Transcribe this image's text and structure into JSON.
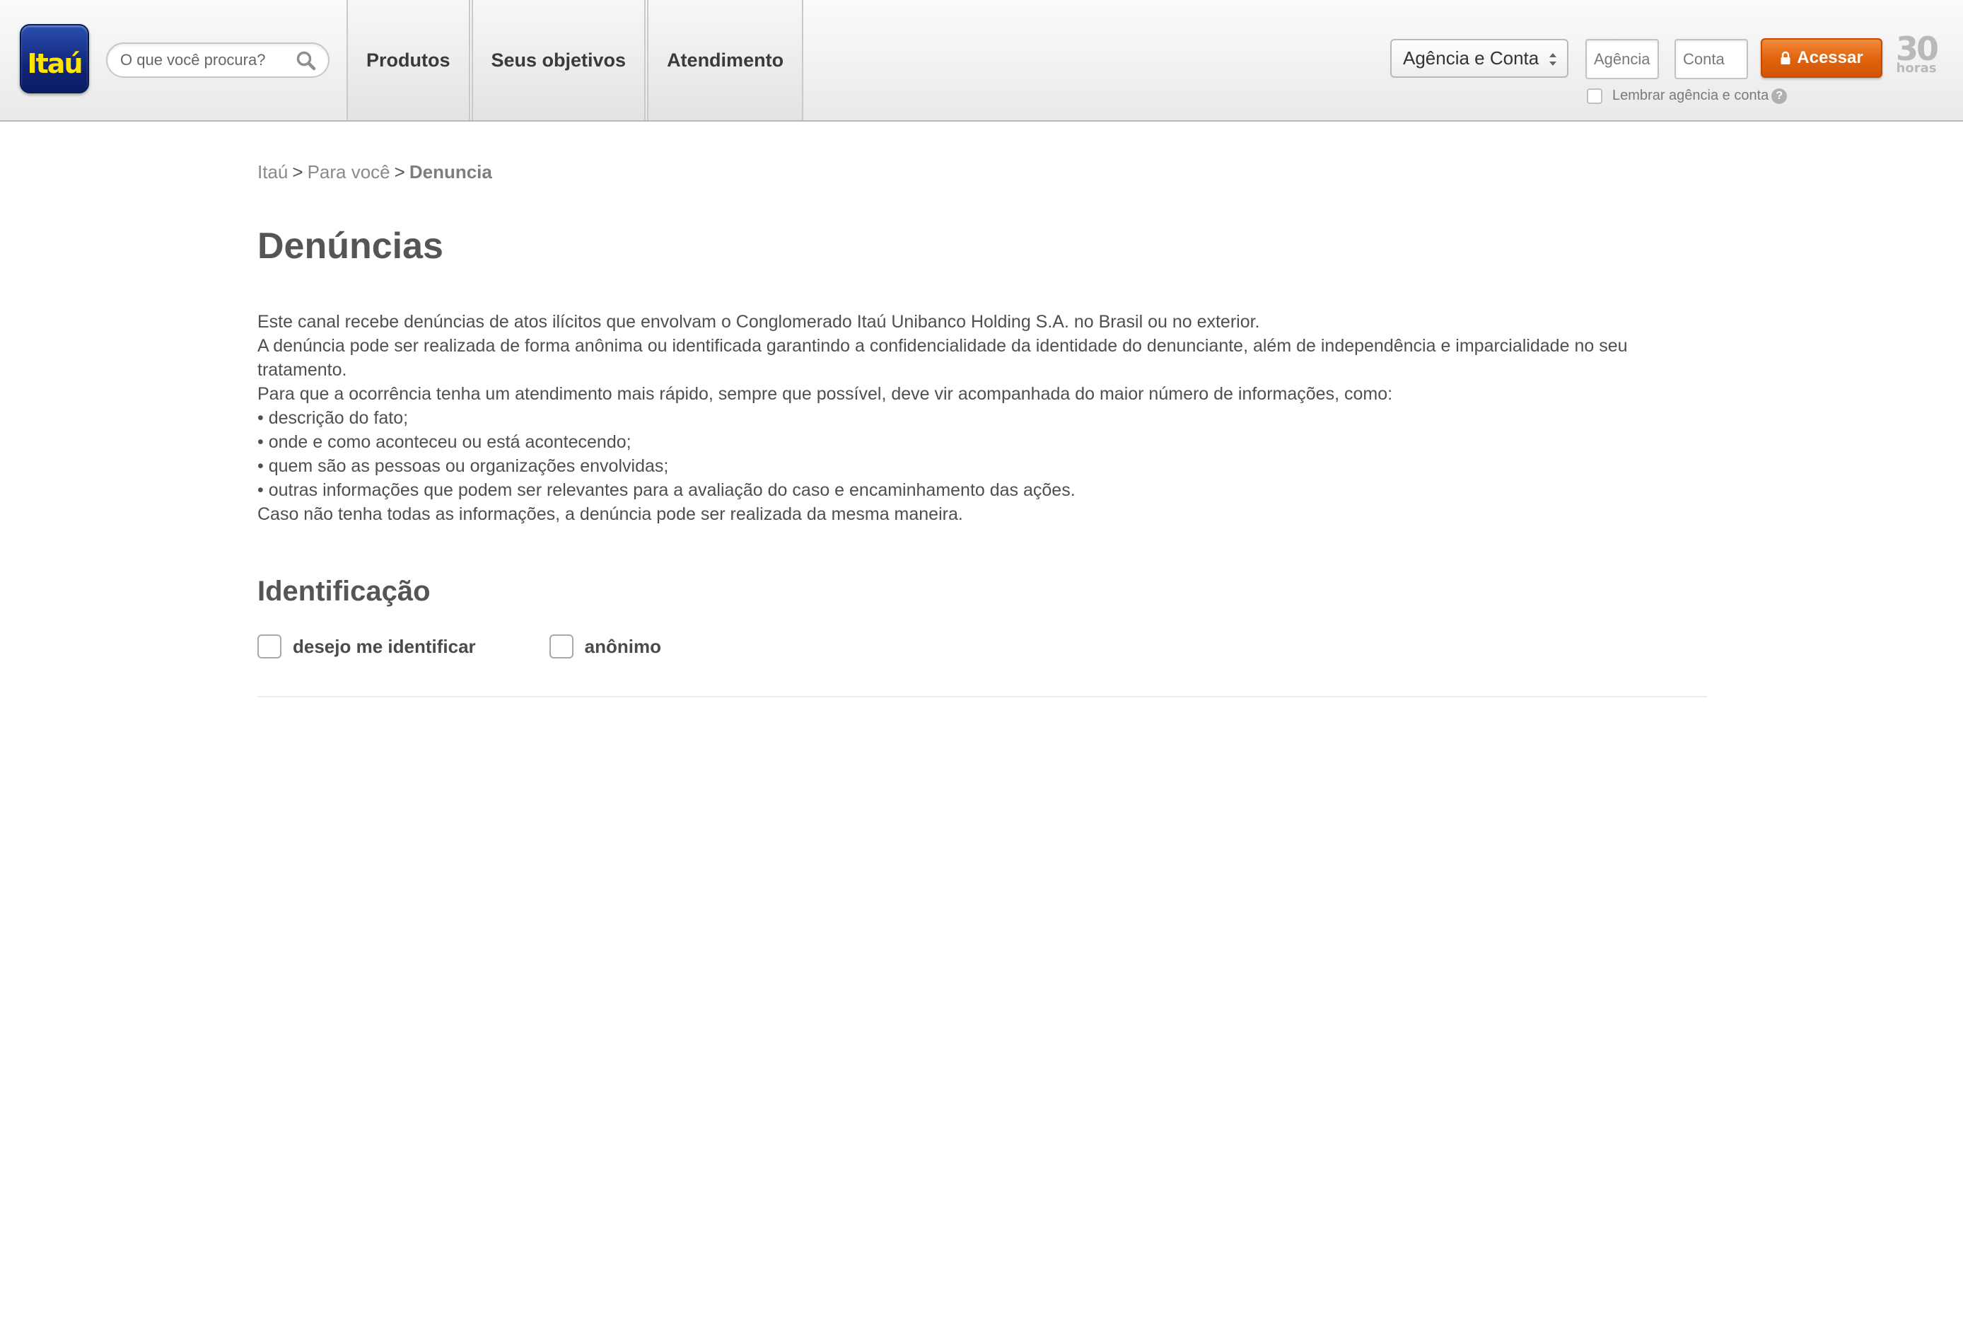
{
  "header": {
    "logo_text": "Itaú",
    "search": {
      "placeholder": "O que você procura?"
    },
    "nav": [
      {
        "label": "Produtos"
      },
      {
        "label": "Seus objetivos"
      },
      {
        "label": "Atendimento"
      }
    ],
    "login": {
      "select_value": "Agência e Conta",
      "agencia_placeholder": "Agência",
      "conta_placeholder": "Conta",
      "button_label": "Acessar",
      "remember_label": "Lembrar agência e conta",
      "help_glyph": "?"
    },
    "badge": {
      "number": "30",
      "word": "horas"
    }
  },
  "breadcrumb": {
    "items": [
      "Itaú",
      "Para você"
    ],
    "separator": ">",
    "current": "Denuncia"
  },
  "page": {
    "title": "Denúncias",
    "paragraphs": [
      "Este canal recebe denúncias de atos ilícitos que envolvam o Conglomerado Itaú Unibanco Holding S.A. no Brasil ou no exterior.",
      "A denúncia pode ser realizada de forma anônima ou identificada garantindo a confidencialidade da identidade do denunciante, além de independência e imparcialidade no seu tratamento.",
      "Para que a ocorrência tenha um atendimento mais rápido, sempre que possível, deve vir acompanhada do maior número de informações, como:",
      "• descrição do fato;",
      "• onde e como aconteceu ou está acontecendo;",
      "• quem são as pessoas ou organizações envolvidas;",
      "• outras informações que podem ser relevantes para a avaliação do caso e encaminhamento das ações.",
      "Caso não tenha todas as informações, a denúncia pode ser realizada da mesma maneira."
    ],
    "identification": {
      "title": "Identificação",
      "options": [
        "desejo me identificar",
        "anônimo"
      ]
    }
  },
  "colors": {
    "brand_blue": "#10267a",
    "brand_yellow": "#ffe600",
    "accent_orange": "#e2620c"
  }
}
